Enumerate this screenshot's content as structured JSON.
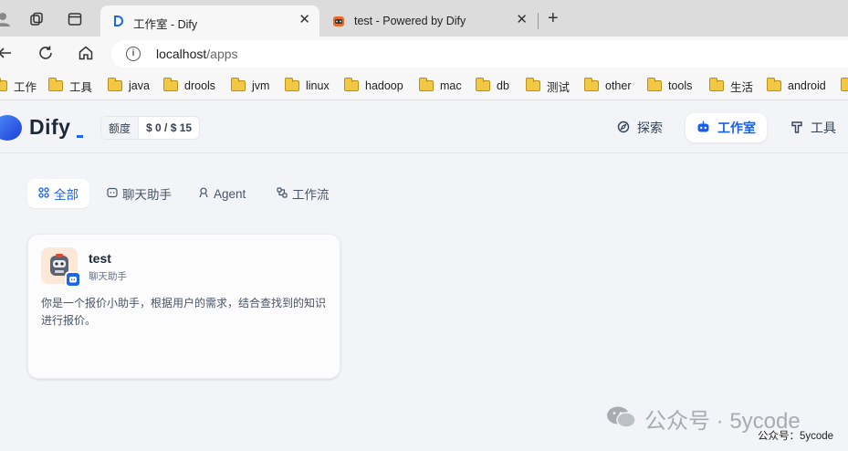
{
  "browser": {
    "tabs": [
      {
        "title": "工作室 - Dify",
        "close": "✕"
      },
      {
        "title": "test - Powered by Dify",
        "close": "✕"
      }
    ],
    "new_tab": "+",
    "address": {
      "host": "localhost",
      "path": "/apps"
    },
    "bookmarks": [
      "工作",
      "工具",
      "java",
      "drools",
      "jvm",
      "linux",
      "hadoop",
      "mac",
      "db",
      "测试",
      "other",
      "tools",
      "生活",
      "android"
    ]
  },
  "header": {
    "logo_text": "Dify",
    "quota_label": "额度",
    "quota_value": "$ 0 / $ 15",
    "nav": [
      {
        "label": "探索",
        "icon": "compass-icon"
      },
      {
        "label": "工作室",
        "icon": "robot-icon"
      },
      {
        "label": "工具",
        "icon": "hammer-icon"
      }
    ]
  },
  "filters": [
    {
      "label": "全部",
      "icon": "grid-icon"
    },
    {
      "label": "聊天助手",
      "icon": "chat-icon"
    },
    {
      "label": "Agent",
      "icon": "agent-icon"
    },
    {
      "label": "工作流",
      "icon": "workflow-icon"
    }
  ],
  "apps": [
    {
      "name": "test",
      "type": "聊天助手",
      "description": "你是一个报价小助手，根据用户的需求，结合查找到的知识进行报价。"
    }
  ],
  "watermark": {
    "main": "公众号 · 5ycode",
    "small": "公众号：5ycode"
  },
  "colors": {
    "accent": "#155eef",
    "background": "#f2f4f7",
    "folder": "#f2c744"
  }
}
